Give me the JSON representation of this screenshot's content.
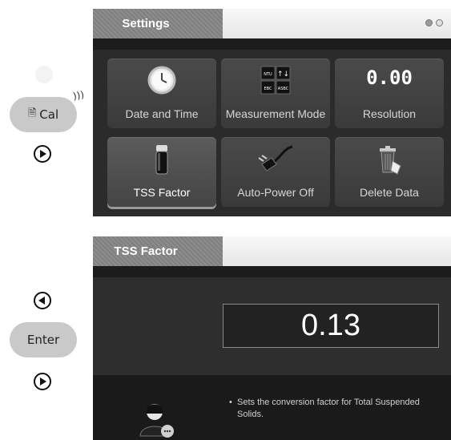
{
  "left_controls": {
    "cal_label": "Cal",
    "enter_label": "Enter"
  },
  "screen1": {
    "title": "Settings",
    "tiles": [
      {
        "label": "Date and Time",
        "icon": "clock-icon"
      },
      {
        "label": "Measurement Mode",
        "icon": "measurement-mode-icon",
        "icon_text": [
          "NTU",
          "EBC",
          "ASBC"
        ]
      },
      {
        "label": "Resolution",
        "icon": "resolution-icon",
        "icon_text": "0.00"
      },
      {
        "label": "TSS Factor",
        "icon": "vial-icon",
        "selected": true
      },
      {
        "label": "Auto-Power Off",
        "icon": "power-plug-icon"
      },
      {
        "label": "Delete Data",
        "icon": "trash-icon"
      }
    ]
  },
  "screen2": {
    "title": "TSS Factor",
    "value": "0.13",
    "info": "Sets the conversion factor for Total Suspended Solids."
  },
  "colors": {
    "screen_bg": "#2b2b2b",
    "tile_bg": "#444444",
    "title_tab": "#888888",
    "button_pill": "#c9c9c9"
  }
}
